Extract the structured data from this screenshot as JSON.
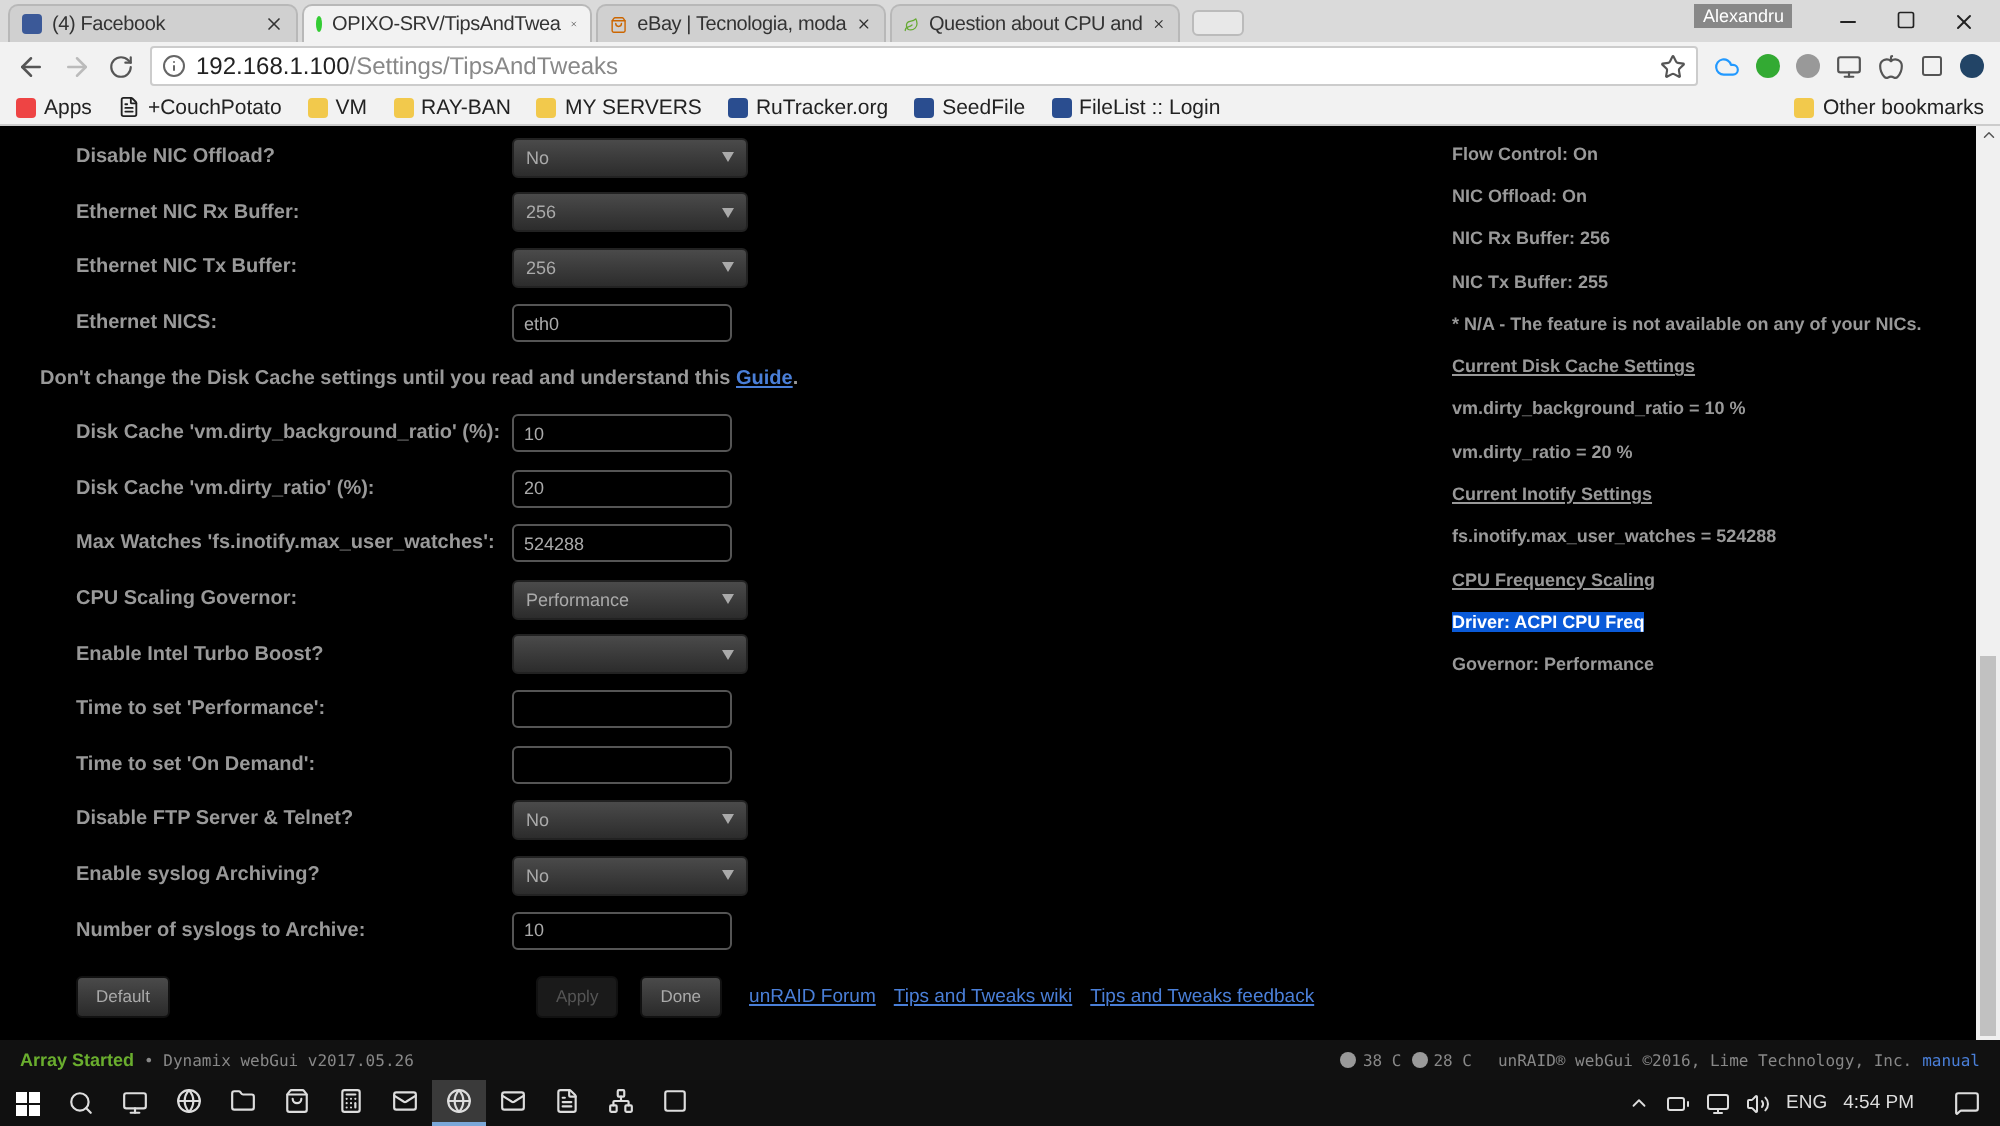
{
  "browser": {
    "tabs": [
      {
        "title": "(4) Facebook",
        "selected": false
      },
      {
        "title": "OPIXO-SRV/TipsAndTwea",
        "selected": true
      },
      {
        "title": "eBay | Tecnologia, moda",
        "selected": false
      },
      {
        "title": "Question about CPU and",
        "selected": false
      }
    ],
    "user": "Alexandru",
    "address": {
      "host": "192.168.1.100",
      "path": "/Settings/TipsAndTweaks"
    },
    "bookmarks": [
      {
        "label": "Apps",
        "kind": "apps"
      },
      {
        "label": "+CouchPotato",
        "kind": "page"
      },
      {
        "label": "VM",
        "kind": "folder"
      },
      {
        "label": "RAY-BAN",
        "kind": "folder"
      },
      {
        "label": "MY SERVERS",
        "kind": "folder"
      },
      {
        "label": "RuTracker.org",
        "kind": "site"
      },
      {
        "label": "SeedFile",
        "kind": "site"
      },
      {
        "label": "FileList :: Login",
        "kind": "site"
      }
    ],
    "other_bookmarks": "Other bookmarks"
  },
  "settings": [
    {
      "kind": "select",
      "label": "Disable NIC Offload?",
      "value": "No"
    },
    {
      "kind": "select",
      "label": "Ethernet NIC Rx Buffer:",
      "value": "256"
    },
    {
      "kind": "select",
      "label": "Ethernet NIC Tx Buffer:",
      "value": "256"
    },
    {
      "kind": "input",
      "label": "Ethernet NICS:",
      "value": "eth0"
    },
    {
      "kind": "note",
      "text": "Don't change the Disk Cache settings until you read and understand this",
      "link": "Guide",
      "suffix": "."
    },
    {
      "kind": "input",
      "label": "Disk Cache 'vm.dirty_background_ratio' (%):",
      "value": "10"
    },
    {
      "kind": "input",
      "label": "Disk Cache 'vm.dirty_ratio' (%):",
      "value": "20"
    },
    {
      "kind": "input",
      "label": "Max Watches 'fs.inotify.max_user_watches':",
      "value": "524288"
    },
    {
      "kind": "select",
      "label": "CPU Scaling Governor:",
      "value": "Performance"
    },
    {
      "kind": "select",
      "label": "Enable Intel Turbo Boost?"
    },
    {
      "kind": "input",
      "label": "Time to set 'Performance':"
    },
    {
      "kind": "input",
      "label": "Time to set 'On Demand':"
    },
    {
      "kind": "select",
      "label": "Disable FTP Server & Telnet?",
      "value": "No"
    },
    {
      "kind": "select",
      "label": "Enable syslog Archiving?",
      "value": "No"
    },
    {
      "kind": "input",
      "label": "Number of syslogs to Archive:",
      "value": "10"
    }
  ],
  "buttons": [
    {
      "label": "Default",
      "disabled": false
    },
    {
      "label": "Apply",
      "disabled": true
    },
    {
      "label": "Done",
      "disabled": false
    }
  ],
  "links": [
    "unRAID Forum",
    "Tips and Tweaks wiki",
    "Tips and Tweaks feedback"
  ],
  "info": [
    {
      "kind": "plain",
      "text": "Flow Control: On"
    },
    {
      "kind": "plain",
      "text": "NIC Offload: On"
    },
    {
      "kind": "plain",
      "text": "NIC Rx Buffer: 256"
    },
    {
      "kind": "plain",
      "text": "NIC Tx Buffer: 255"
    },
    {
      "kind": "plain",
      "text": "* N/A - The feature is not available on any of your NICs."
    },
    {
      "kind": "heading",
      "text": "Current Disk Cache Settings"
    },
    {
      "kind": "plain",
      "text": "vm.dirty_background_ratio = 10 %"
    },
    {
      "kind": "plain",
      "text": "vm.dirty_ratio = 20 %"
    },
    {
      "kind": "heading",
      "text": "Current Inotify Settings"
    },
    {
      "kind": "plain",
      "text": "fs.inotify.max_user_watches = 524288"
    },
    {
      "kind": "heading",
      "text": "CPU Frequency Scaling"
    },
    {
      "kind": "highlighted",
      "text": "Driver: ACPI CPU Freq"
    },
    {
      "kind": "plain",
      "text": "Governor: Performance"
    }
  ],
  "status_bar": {
    "array": "Array Started",
    "version": "• Dynamix webGui v2017.05.26",
    "temps": [
      "38 C",
      "28 C"
    ],
    "copyright": "unRAID® webGui ©2016, Lime Technology, Inc.",
    "manual": "manual"
  },
  "taskbar": {
    "apps": [
      {
        "kind": "edge",
        "active": false
      },
      {
        "kind": "folder",
        "active": false
      },
      {
        "kind": "store",
        "active": false
      },
      {
        "kind": "calculator",
        "active": false
      },
      {
        "kind": "mail",
        "active": false
      },
      {
        "kind": "chrome",
        "active": true
      },
      {
        "kind": "outlook",
        "active": false
      },
      {
        "kind": "notepad",
        "active": false
      },
      {
        "kind": "network",
        "active": false
      },
      {
        "kind": "filezilla",
        "active": false
      }
    ],
    "language": "ENG",
    "time": "4:54 PM"
  }
}
